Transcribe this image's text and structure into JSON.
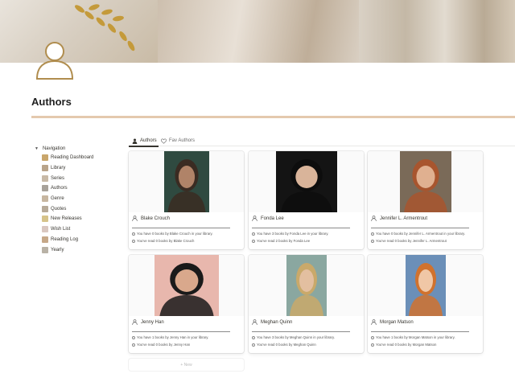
{
  "page": {
    "title": "Authors"
  },
  "nav": {
    "header": "Navigation",
    "items": [
      {
        "label": "Reading Dashboard",
        "icon": "book-icon",
        "color": "#c9a66b"
      },
      {
        "label": "Library",
        "icon": "library-icon",
        "color": "#b9a48a"
      },
      {
        "label": "Series",
        "icon": "series-icon",
        "color": "#c8b9a6"
      },
      {
        "label": "Authors",
        "icon": "person-icon",
        "color": "#a8a29a"
      },
      {
        "label": "Genre",
        "icon": "tag-icon",
        "color": "#c7b6a0"
      },
      {
        "label": "Quotes",
        "icon": "quote-icon",
        "color": "#b7aa98"
      },
      {
        "label": "New Releases",
        "icon": "star-icon",
        "color": "#d6c38a"
      },
      {
        "label": "Wish List",
        "icon": "heart-icon",
        "color": "#d9c7c0"
      },
      {
        "label": "Reading Log",
        "icon": "log-icon",
        "color": "#c6a888"
      },
      {
        "label": "Yearly",
        "icon": "calendar-icon",
        "color": "#b9b2a6"
      }
    ]
  },
  "tabs": [
    {
      "label": "Authors",
      "icon": "person-icon",
      "active": true
    },
    {
      "label": "Fav Authors",
      "icon": "heart-icon",
      "active": false
    }
  ],
  "cards": [
    {
      "name": "Blake Crouch",
      "line1": "You have 0 books by Blake Crouch in your library.",
      "line2": "You've read 0 books by Blake Crouch",
      "bg": "#2f4a40",
      "skin": "#b08368",
      "hair": "#3a2b22"
    },
    {
      "name": "Fonda Lee",
      "line1": "You have 3 books by Fonda Lee in your library.",
      "line2": "You've read 2 books by Fonda Lee",
      "bg": "#141414",
      "skin": "#d9b49a",
      "hair": "#0d0d0d"
    },
    {
      "name": "Jennifer L. Armentrout",
      "line1": "You have 0 books by Jennifer L. Armentrout in your library.",
      "line2": "You've read 0 books by Jennifer L. Armentrout",
      "bg": "#7a6a58",
      "skin": "#e0b090",
      "hair": "#a8552e"
    },
    {
      "name": "Jenny Han",
      "line1": "You have 1 books by Jenny Han in your library.",
      "line2": "You've read 0 books by Jenny Han",
      "bg": "#e8b7ad",
      "skin": "#d9a88c",
      "hair": "#1a1a1a"
    },
    {
      "name": "Meghan Quinn",
      "line1": "You have 3 books by Meghan Quinn in your library.",
      "line2": "You've read 0 books by Meghan Quinn",
      "bg": "#8aa7a0",
      "skin": "#e3bfa0",
      "hair": "#c9a96a"
    },
    {
      "name": "Morgan Matson",
      "line1": "You have 1 books by Morgan Matson in your library.",
      "line2": "You've read 0 books by Morgan Matson",
      "bg": "#6b8fb8",
      "skin": "#f0c7a6",
      "hair": "#d0722e"
    }
  ],
  "new_button": {
    "label": "+ New"
  }
}
